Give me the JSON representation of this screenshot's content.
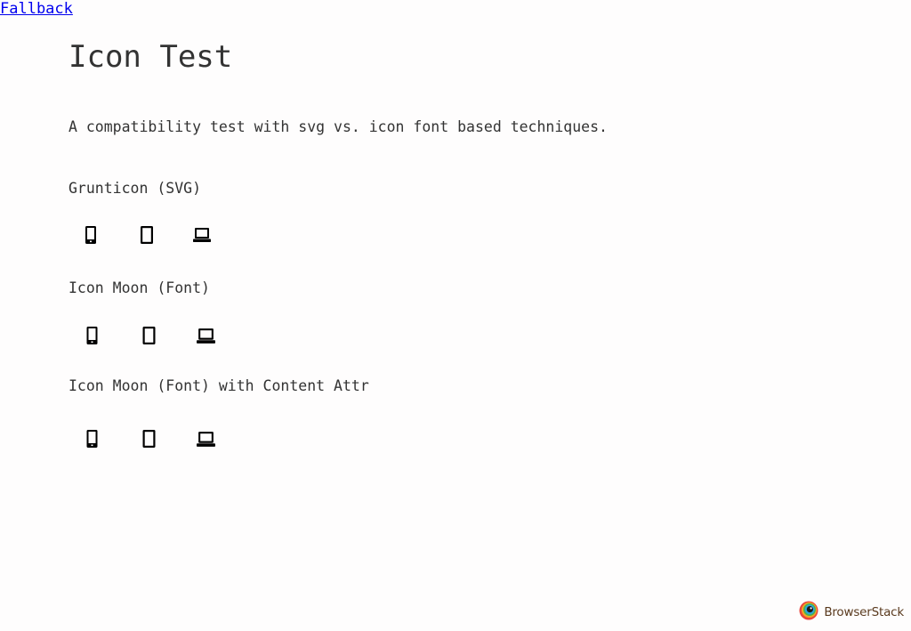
{
  "fallback_link": "Fallback",
  "page_title": "Icon Test",
  "intro": "A compatibility test with svg vs. icon font based techniques.",
  "sections": [
    {
      "heading": "Grunticon (SVG)",
      "icons": [
        "phone-icon",
        "tablet-icon",
        "laptop-icon"
      ]
    },
    {
      "heading": "Icon Moon (Font)",
      "icons": [
        "phone-icon",
        "tablet-icon",
        "laptop-icon"
      ]
    },
    {
      "heading": "Icon Moon (Font) with Content Attr",
      "icons": [
        "phone-icon",
        "tablet-icon",
        "laptop-icon"
      ]
    }
  ],
  "footer": {
    "brand_name": "BrowserStack",
    "brand_icon": "browserstack-logo-icon"
  },
  "colors": {
    "background": "#fefdfd",
    "text": "#333333",
    "link": "#0000ee",
    "icon": "#000000"
  }
}
